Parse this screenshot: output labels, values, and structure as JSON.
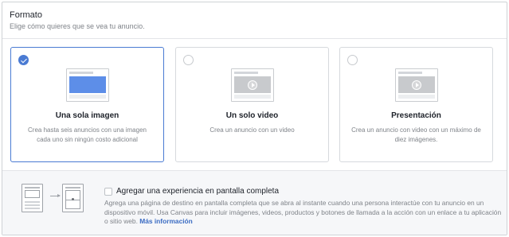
{
  "header": {
    "title": "Formato",
    "subtitle": "Elige cómo quieres que se vea tu anuncio."
  },
  "cards": [
    {
      "title": "Una sola imagen",
      "description": "Crea hasta seis anuncios con una imagen cada uno sin ningún costo adicional",
      "selected": true,
      "icon": "single-image-icon"
    },
    {
      "title": "Un solo video",
      "description": "Crea un anuncio con un video",
      "selected": false,
      "icon": "video-icon"
    },
    {
      "title": "Presentación",
      "description": "Crea un anuncio con video con un máximo de diez imágenes.",
      "selected": false,
      "icon": "slideshow-icon"
    }
  ],
  "fullscreen": {
    "title": "Agregar una experiencia en pantalla completa",
    "description": "Agrega una página de destino en pantalla completa que se abra al instante cuando una persona interactúe con tu anuncio en un dispositivo móvil. Usa Canvas para incluir imágenes, videos, productos y botones de llamada a la acción con un enlace a tu aplicación o sitio web.",
    "link": "Más información",
    "checked": false
  },
  "colors": {
    "accent": "#4a7bd3",
    "image_fill": "#5d8ee8",
    "link": "#3b6cc3"
  }
}
